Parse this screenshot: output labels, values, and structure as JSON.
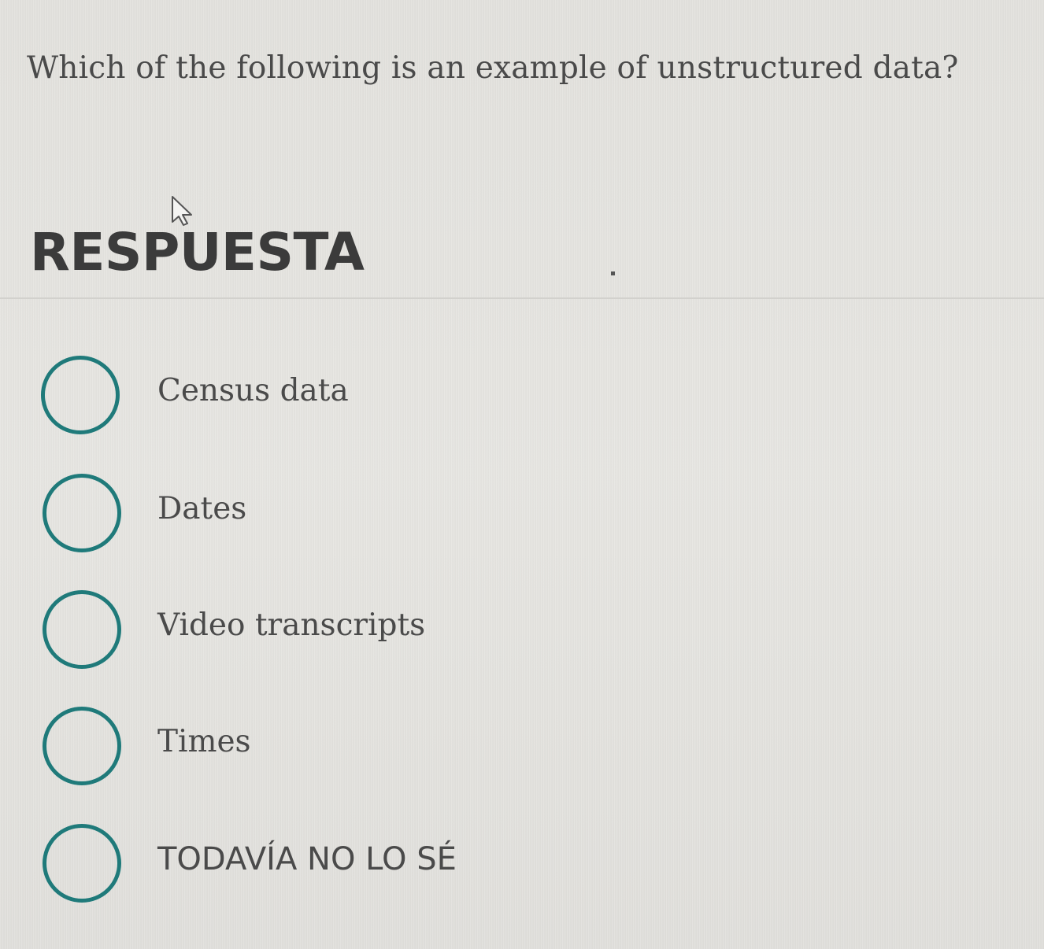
{
  "question": {
    "text": "Which of the following is an example of unstructured data?"
  },
  "answer_section": {
    "title": "RESPUESTA"
  },
  "options": [
    {
      "label": "Census data"
    },
    {
      "label": "Dates"
    },
    {
      "label": "Video transcripts"
    },
    {
      "label": "Times"
    },
    {
      "label": "TODAVÍA NO LO SÉ"
    }
  ],
  "colors": {
    "radio_border": "#1f7a7a",
    "text": "#4a4a4a",
    "background": "#e4e3df"
  },
  "icons": {
    "cursor": "mouse-pointer-icon"
  }
}
